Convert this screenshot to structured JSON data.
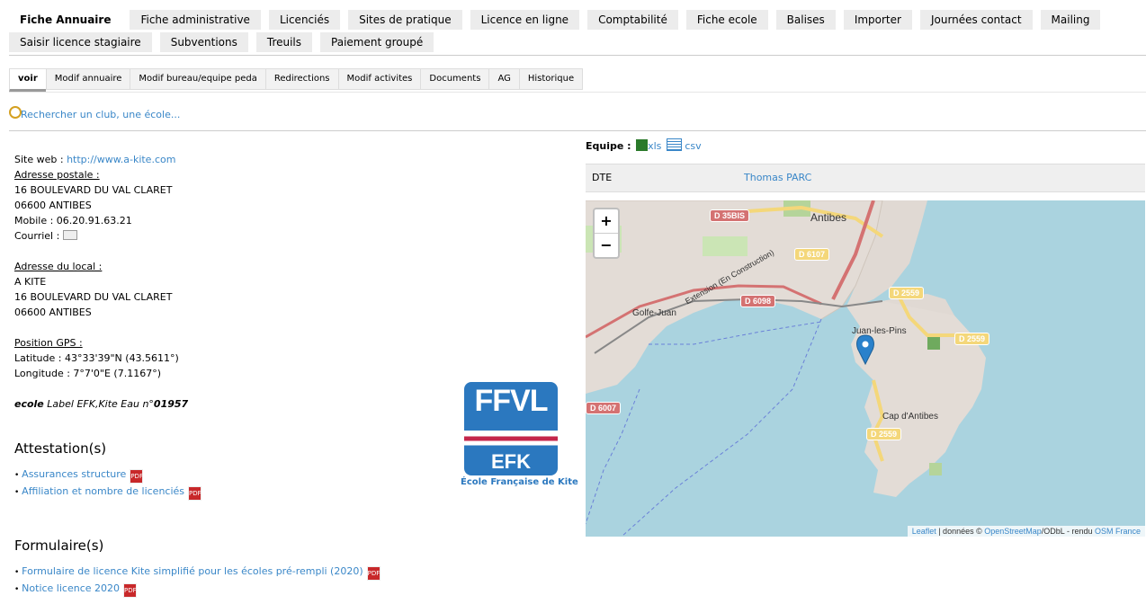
{
  "main_tabs_row1": [
    "Fiche Annuaire",
    "Fiche administrative",
    "Licenciés",
    "Sites de pratique",
    "Licence en ligne",
    "Comptabilité",
    "Fiche ecole",
    "Balises",
    "Importer",
    "Journées contact",
    "Mailing"
  ],
  "main_tabs_row2": [
    "Saisir licence stagiaire",
    "Subventions",
    "Treuils",
    "Paiement groupé"
  ],
  "sub_tabs": [
    "voir",
    "Modif annuaire",
    "Modif bureau/equipe peda",
    "Redirections",
    "Modif activites",
    "Documents",
    "AG",
    "Historique"
  ],
  "search_link": "Rechercher un club, une école...",
  "site": {
    "label": "Site web : ",
    "url": "http://www.a-kite.com"
  },
  "postal": {
    "heading": "Adresse postale :",
    "line1": "16 BOULEVARD DU VAL CLARET",
    "line2": "06600 ANTIBES",
    "mobile": "Mobile : 06.20.91.63.21",
    "courriel": "Courriel : "
  },
  "local": {
    "heading": "Adresse du local :",
    "name": "A KITE",
    "line1": "16 BOULEVARD DU VAL CLARET",
    "line2": "06600 ANTIBES"
  },
  "gps": {
    "heading": "Position GPS :",
    "lat": "Latitude : 43°33'39\"N (43.5611°)",
    "lon": "Longitude : 7°7'0\"E (7.1167°)"
  },
  "label": {
    "kind": "ecole",
    "text": "Label EFK,Kite Eau n°",
    "number": "01957"
  },
  "attestations": {
    "title": "Attestation(s)",
    "items": [
      "Assurances structure",
      "Affiliation et nombre de licenciés"
    ]
  },
  "formulaires": {
    "title": "Formulaire(s)",
    "items": [
      "Formulaire de licence Kite simplifié pour les écoles pré-rempli (2020)",
      "Notice licence 2020"
    ]
  },
  "logo": {
    "top": "FFVL",
    "bottom": "EFK",
    "caption": "École Française de Kite",
    "colors": {
      "blue": "#2b78bf",
      "red": "#c4264b"
    }
  },
  "equipe": {
    "label": "Equipe :",
    "xls": "xls",
    "csv": "csv",
    "role": "DTE",
    "person": "Thomas PARC"
  },
  "map": {
    "zoom_in": "+",
    "zoom_out": "−",
    "attribution": {
      "leaflet": "Leaflet",
      "sep": " | données © ",
      "osm": "OpenStreetMap",
      "odbl": "/ODbL - rendu ",
      "osmfr": "OSM France"
    },
    "roads": [
      "D 35BIS",
      "D 6107",
      "D 6098",
      "D 2559",
      "D 2559",
      "D 2559",
      "D 6007",
      "D 2559"
    ],
    "places": [
      "Antibes",
      "Juan-les-Pins",
      "Cap d'Antibes",
      "Golfe-Juan",
      "Extension (En Construction)"
    ]
  }
}
